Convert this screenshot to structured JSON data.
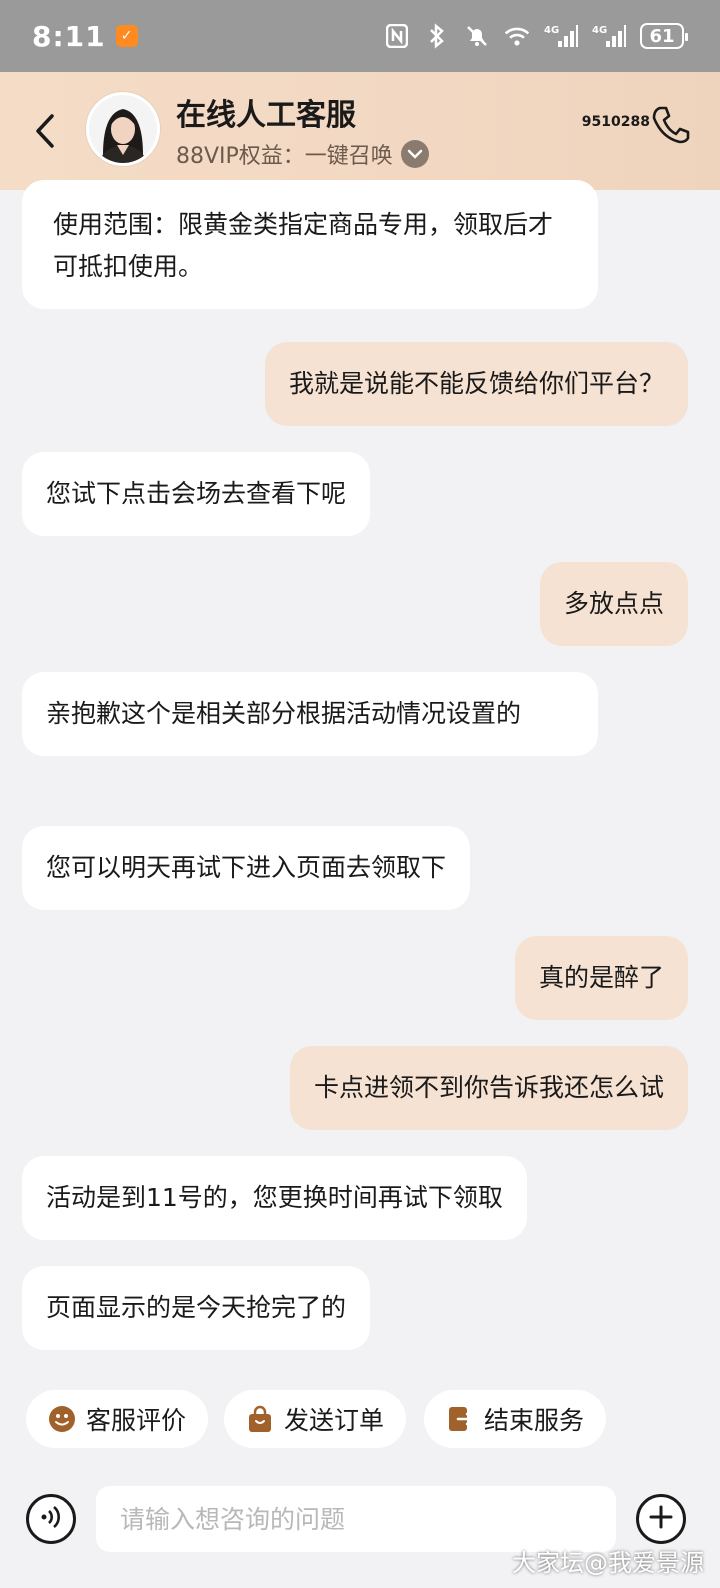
{
  "status_bar": {
    "time": "8:11",
    "network_1": "4G",
    "network_2": "4G",
    "battery": "61"
  },
  "header": {
    "title": "在线人工客服",
    "subtitle": "88VIP权益：一键召唤",
    "phone_number": "9510288"
  },
  "messages": [
    {
      "side": "left",
      "text": "使用范围：限黄金类指定商品专用，领取后才可抵扣使用。"
    },
    {
      "side": "right",
      "text": "我就是说能不能反馈给你们平台？"
    },
    {
      "side": "left",
      "text": "您试下点击会场去查看下呢"
    },
    {
      "side": "right",
      "text": "多放点点"
    },
    {
      "side": "left",
      "text": "亲抱歉这个是相关部分根据活动情况设置的"
    },
    {
      "side": "left",
      "text": "您可以明天再试下进入页面去领取下"
    },
    {
      "side": "right",
      "text": "真的是醉了"
    },
    {
      "side": "right",
      "text": "卡点进领不到你告诉我还怎么试"
    },
    {
      "side": "left",
      "text": "活动是到11号的，您更换时间再试下领取"
    },
    {
      "side": "left",
      "text": "页面显示的是今天抢完了的"
    }
  ],
  "quick_actions": {
    "rate": "客服评价",
    "send_order": "发送订单",
    "end_service": "结束服务"
  },
  "input": {
    "placeholder": "请输入想咨询的问题"
  },
  "watermark": "大家坛@我爱景源",
  "colors": {
    "header_bg": "#f3d9c3",
    "user_bubble": "#f5e2d2",
    "agent_bubble": "#ffffff",
    "icon_brown": "#a0612a"
  }
}
